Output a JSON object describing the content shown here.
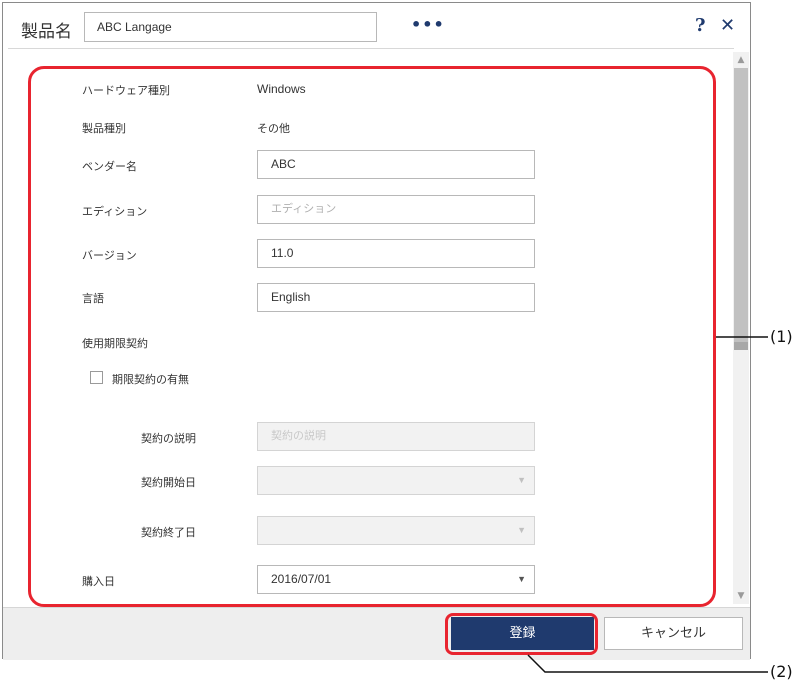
{
  "header": {
    "title": "製品名",
    "product_name_value": "ABC Langage",
    "more_label": "•••",
    "help_label": "?",
    "close_label": "✕"
  },
  "form": {
    "hardware_type": {
      "label": "ハードウェア種別",
      "value": "Windows"
    },
    "product_type": {
      "label": "製品種別",
      "value": "その他"
    },
    "vendor": {
      "label": "ベンダー名",
      "value": "ABC"
    },
    "edition": {
      "label": "エディション",
      "placeholder": "エディション"
    },
    "version": {
      "label": "バージョン",
      "value": "11.0"
    },
    "language": {
      "label": "言語",
      "value": "English"
    },
    "license_section": {
      "label": "使用期限契約"
    },
    "license_checkbox": {
      "label": "期限契約の有無",
      "checked": false
    },
    "contract_description": {
      "label": "契約の説明",
      "placeholder": "契約の説明"
    },
    "contract_start": {
      "label": "契約開始日",
      "value": ""
    },
    "contract_end": {
      "label": "契約終了日",
      "value": ""
    },
    "purchase_date": {
      "label": "購入日",
      "value": "2016/07/01"
    }
  },
  "footer": {
    "register_label": "登録",
    "cancel_label": "キャンセル"
  },
  "annotations": {
    "callout_1": "(1)",
    "callout_2": "(2)"
  },
  "colors": {
    "accent": "#1f3a6e",
    "annotation": "#e8242f"
  }
}
